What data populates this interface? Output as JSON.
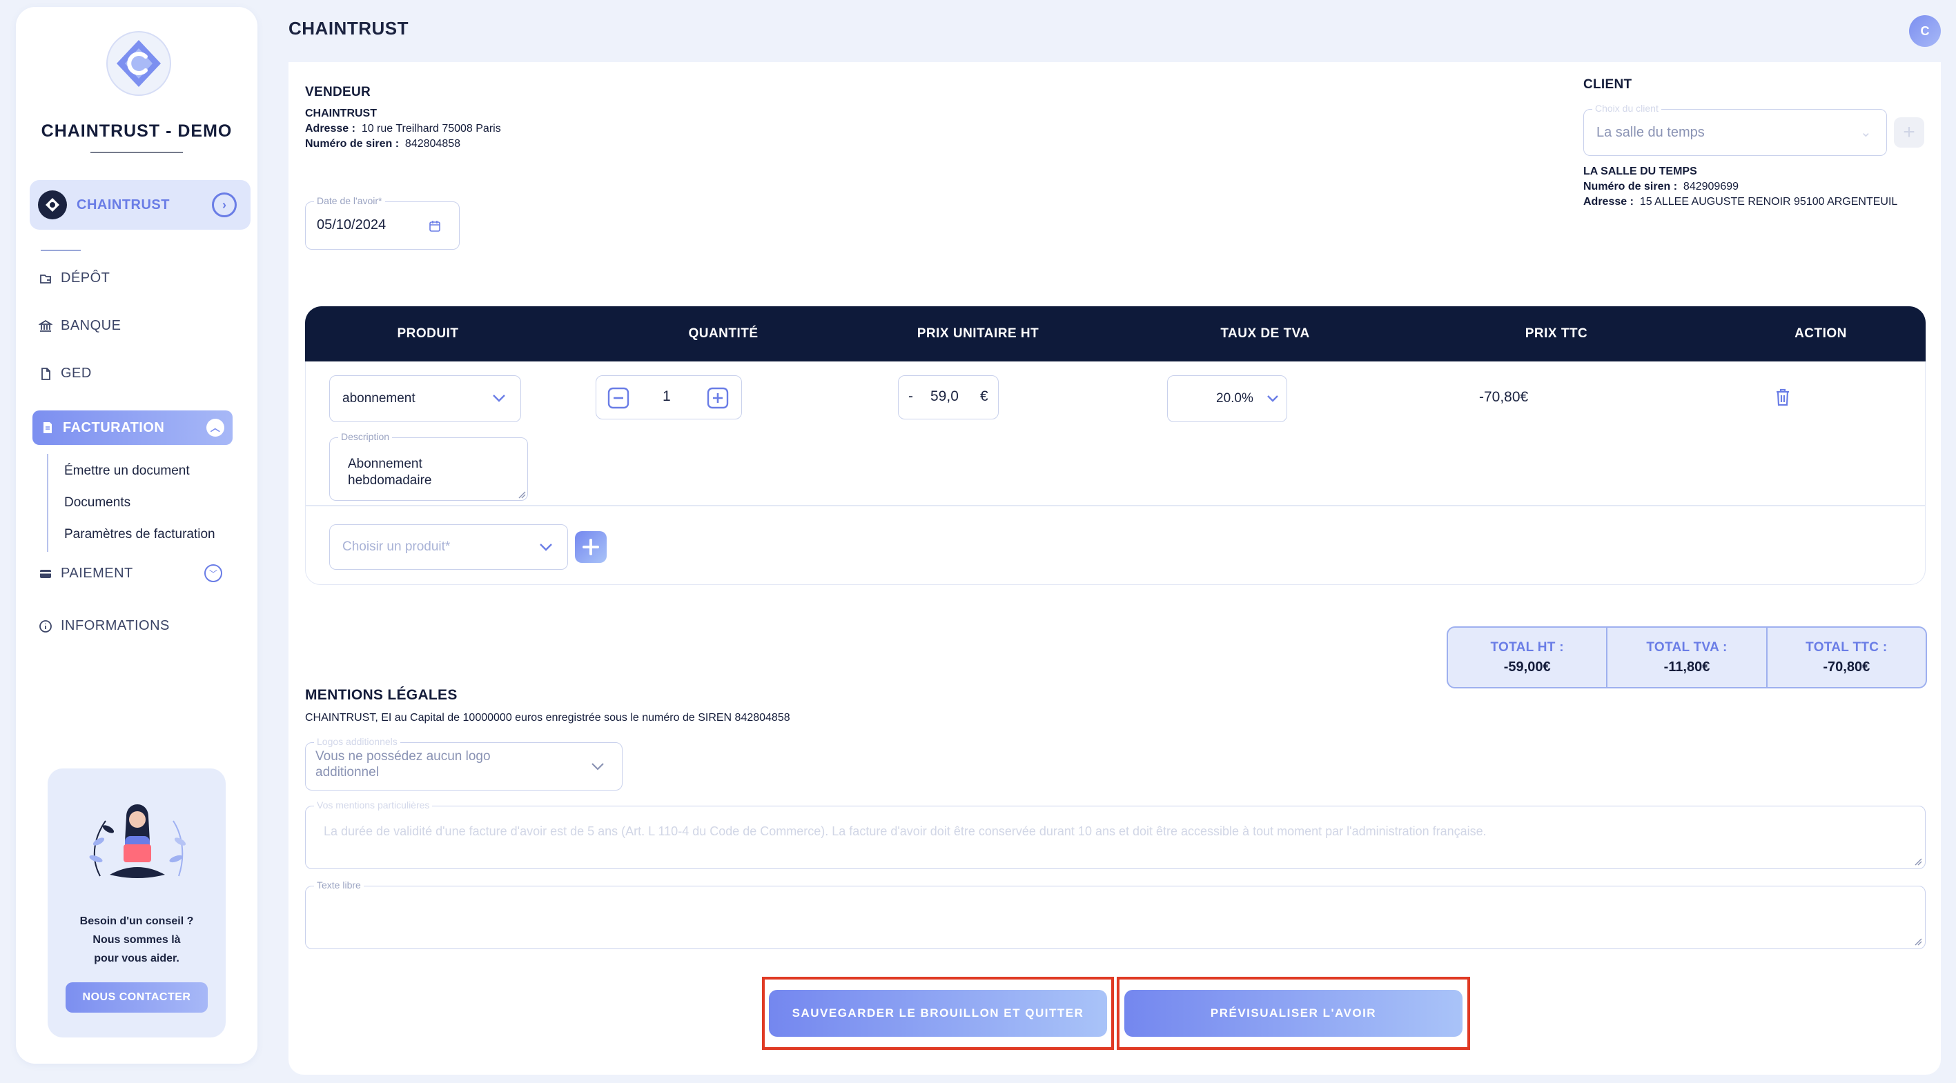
{
  "app": {
    "title": "CHAINTRUST",
    "user_initial": "C"
  },
  "sidebar": {
    "brand": "CHAINTRUST - DEMO",
    "company": "CHAINTRUST",
    "nav": [
      {
        "label": "DÉPÔT",
        "icon": "deposit-icon"
      },
      {
        "label": "BANQUE",
        "icon": "bank-icon"
      },
      {
        "label": "GED",
        "icon": "document-icon"
      },
      {
        "label": "FACTURATION",
        "icon": "invoice-icon"
      },
      {
        "label": "PAIEMENT",
        "icon": "card-icon"
      },
      {
        "label": "INFORMATIONS",
        "icon": "info-icon"
      }
    ],
    "sub_items": [
      "Émettre un document",
      "Documents",
      "Paramètres de facturation"
    ],
    "help": {
      "line1": "Besoin d'un conseil ?",
      "line2": "Nous sommes là",
      "line3": "pour vous aider.",
      "button": "NOUS CONTACTER"
    }
  },
  "vendor": {
    "heading": "VENDEUR",
    "name": "CHAINTRUST",
    "address_label": "Adresse :",
    "address": "10 rue Treilhard 75008 Paris",
    "siren_label": "Numéro de siren :",
    "siren": "842804858"
  },
  "credit_date": {
    "label": "Date de l'avoir*",
    "value": "05/10/2024"
  },
  "client": {
    "heading": "CLIENT",
    "select_label": "Choix du client",
    "select_value": "La salle du temps",
    "name": "LA SALLE DU TEMPS",
    "siren_label": "Numéro de siren :",
    "siren": "842909699",
    "address_label": "Adresse :",
    "address": "15 ALLEE AUGUSTE RENOIR 95100 ARGENTEUIL"
  },
  "table": {
    "headers": [
      "PRODUIT",
      "QUANTITÉ",
      "PRIX UNITAIRE HT",
      "TAUX DE TVA",
      "PRIX TTC",
      "ACTION"
    ],
    "row": {
      "product": "abonnement",
      "quantity": "1",
      "price_sign": "-",
      "price": "59,0",
      "currency": "€",
      "vat": "20.0%",
      "total_ttc": "-70,80€",
      "description_label": "Description",
      "description": "Abonnement hebdomadaire"
    },
    "add_product_placeholder": "Choisir un produit*"
  },
  "totals": [
    {
      "label": "TOTAL HT :",
      "value": "-59,00€"
    },
    {
      "label": "TOTAL TVA :",
      "value": "-11,80€"
    },
    {
      "label": "TOTAL TTC :",
      "value": "-70,80€"
    }
  ],
  "legal": {
    "heading": "MENTIONS LÉGALES",
    "text": "CHAINTRUST, EI au Capital de 10000000 euros enregistrée sous le numéro de SIREN 842804858",
    "logos_label": "Logos additionnels",
    "logos_value": "Vous ne possédez aucun logo additionnel",
    "mentions_label": "Vos mentions particulières",
    "mentions_placeholder": "La durée de validité d'une facture d'avoir est de 5 ans (Art. L 110-4 du Code de Commerce). La facture d'avoir doit être conservée durant 10 ans et doit être accessible à tout moment par l'administration française.",
    "free_text_label": "Texte libre"
  },
  "actions": {
    "save_draft": "SAUVEGARDER LE BROUILLON ET QUITTER",
    "preview": "PRÉVISUALISER L'AVOIR"
  },
  "colors": {
    "accent": "#7487ef",
    "navy": "#0e1a3a",
    "highlight": "#e03a24",
    "background": "#eef2fb"
  }
}
